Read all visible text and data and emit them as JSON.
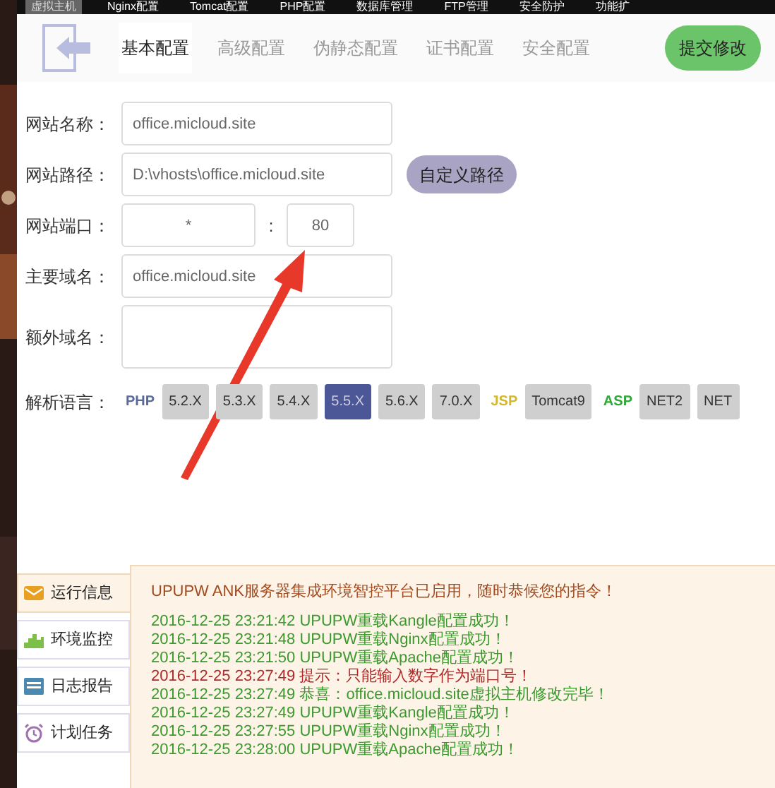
{
  "top_menu": [
    {
      "label": "虚拟主机",
      "selected": true
    },
    {
      "label": "Nginx配置",
      "selected": false
    },
    {
      "label": "Tomcat配置",
      "selected": false
    },
    {
      "label": "PHP配置",
      "selected": false
    },
    {
      "label": "数据库管理",
      "selected": false
    },
    {
      "label": "FTP管理",
      "selected": false
    },
    {
      "label": "安全防护",
      "selected": false
    },
    {
      "label": "功能扩",
      "selected": false
    }
  ],
  "tabs": [
    {
      "label": "基本配置",
      "selected": true
    },
    {
      "label": "高级配置",
      "selected": false
    },
    {
      "label": "伪静态配置",
      "selected": false
    },
    {
      "label": "证书配置",
      "selected": false
    },
    {
      "label": "安全配置",
      "selected": false
    }
  ],
  "submit_button": "提交修改",
  "form": {
    "site_name": {
      "label": "网站名称：",
      "value": "office.micloud.site"
    },
    "site_path": {
      "label": "网站路径：",
      "value": "D:\\vhosts\\office.micloud.site",
      "button": "自定义路径"
    },
    "site_port": {
      "label": "网站端口：",
      "host": "*",
      "separator": ":",
      "port": "80"
    },
    "main_domain": {
      "label": "主要域名：",
      "value": "office.micloud.site"
    },
    "extra_domains": {
      "label": "额外域名："
    },
    "language": {
      "label": "解析语言：",
      "options": [
        {
          "kind": "label",
          "text": "PHP",
          "color": "#5b6a9c"
        },
        {
          "kind": "version",
          "text": "5.2.X",
          "selected": false
        },
        {
          "kind": "version",
          "text": "5.3.X",
          "selected": false
        },
        {
          "kind": "version",
          "text": "5.4.X",
          "selected": false
        },
        {
          "kind": "version",
          "text": "5.5.X",
          "selected": true
        },
        {
          "kind": "version",
          "text": "5.6.X",
          "selected": false
        },
        {
          "kind": "version",
          "text": "7.0.X",
          "selected": false
        },
        {
          "kind": "label",
          "text": "JSP",
          "color": "#d4b82a"
        },
        {
          "kind": "version",
          "text": "Tomcat9",
          "selected": false
        },
        {
          "kind": "label",
          "text": "ASP",
          "color": "#2ea836"
        },
        {
          "kind": "version",
          "text": "NET2",
          "selected": false
        },
        {
          "kind": "version",
          "text": "NET",
          "selected": false
        }
      ]
    }
  },
  "side_tabs": [
    {
      "label": "运行信息",
      "selected": true
    },
    {
      "label": "环境监控",
      "selected": false
    },
    {
      "label": "日志报告",
      "selected": false
    },
    {
      "label": "计划任务",
      "selected": false
    }
  ],
  "log": {
    "banner": "UPUPW ANK服务器集成环境智控平台已启用，随时恭候您的指令！",
    "lines": [
      {
        "text": "2016-12-25 23:21:42 UPUPW重载Kangle配置成功！",
        "color": "#3a9a2e"
      },
      {
        "text": "2016-12-25 23:21:48 UPUPW重载Nginx配置成功！",
        "color": "#3a9a2e"
      },
      {
        "text": "2016-12-25 23:21:50 UPUPW重载Apache配置成功！",
        "color": "#3a9a2e"
      },
      {
        "text": "2016-12-25 23:27:49 提示：只能输入数字作为端口号！",
        "color": "#b02a2a"
      },
      {
        "text": "2016-12-25 23:27:49 恭喜：office.micloud.site虚拟主机修改完毕！",
        "color": "#3a9a2e"
      },
      {
        "text": "2016-12-25 23:27:49 UPUPW重载Kangle配置成功！",
        "color": "#3a9a2e"
      },
      {
        "text": "2016-12-25 23:27:55 UPUPW重载Nginx配置成功！",
        "color": "#3a9a2e"
      },
      {
        "text": "2016-12-25 23:28:00 UPUPW重载Apache配置成功！",
        "color": "#3a9a2e"
      }
    ]
  }
}
